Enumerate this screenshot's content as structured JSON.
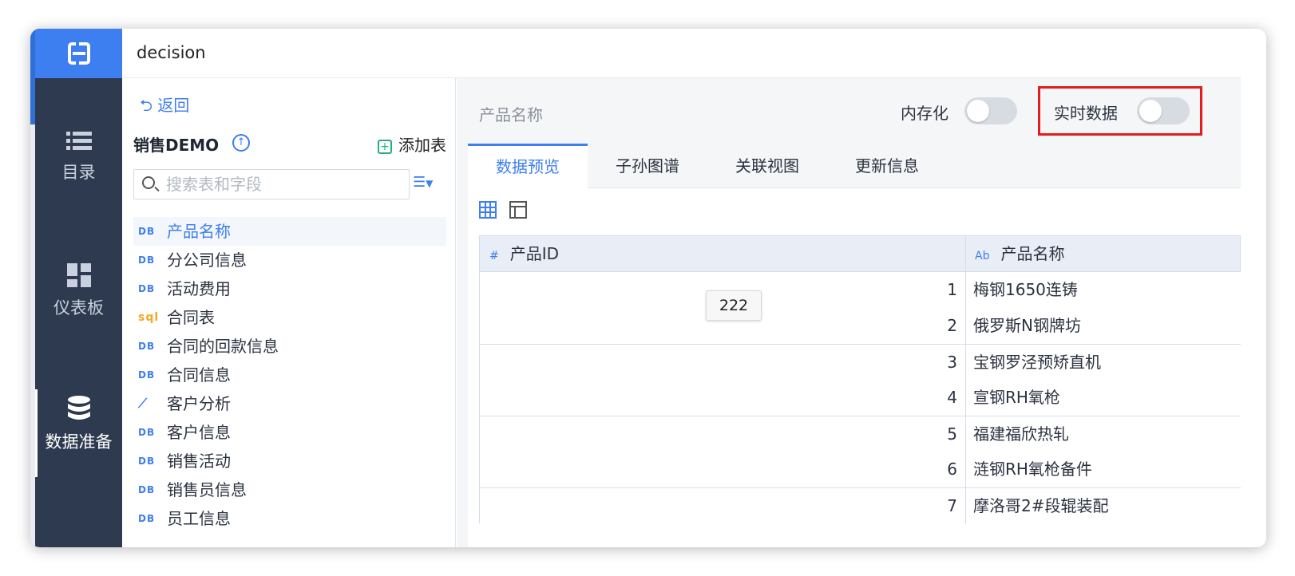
{
  "app": {
    "title": "decision"
  },
  "nav": {
    "items": [
      {
        "label": "目录",
        "icon": "list-icon"
      },
      {
        "label": "仪表板",
        "icon": "dashboard-icon"
      },
      {
        "label": "数据准备",
        "icon": "database-icon",
        "active": true
      }
    ]
  },
  "left_panel": {
    "back_label": "返回",
    "package_name": "销售DEMO",
    "add_table_label": "添加表",
    "search_placeholder": "搜索表和字段",
    "tables": [
      {
        "tag": "DB",
        "label": "产品名称",
        "selected": true
      },
      {
        "tag": "DB",
        "label": "分公司信息"
      },
      {
        "tag": "DB",
        "label": "活动费用"
      },
      {
        "tag": "sql",
        "label": "合同表"
      },
      {
        "tag": "DB",
        "label": "合同的回款信息"
      },
      {
        "tag": "DB",
        "label": "合同信息"
      },
      {
        "tag": "analysis",
        "label": "客户分析"
      },
      {
        "tag": "DB",
        "label": "客户信息"
      },
      {
        "tag": "DB",
        "label": "销售活动"
      },
      {
        "tag": "DB",
        "label": "销售员信息"
      },
      {
        "tag": "DB",
        "label": "员工信息"
      }
    ]
  },
  "right_panel": {
    "title": "产品名称",
    "memory_label": "内存化",
    "realtime_label": "实时数据",
    "tabs": [
      "数据预览",
      "子孙图谱",
      "关联视图",
      "更新信息"
    ],
    "columns": [
      {
        "type": "#",
        "label": "产品ID"
      },
      {
        "type": "Ab",
        "label": "产品名称"
      }
    ],
    "rows": [
      {
        "id": "1",
        "name": "梅钢1650连铸"
      },
      {
        "id": "2",
        "name": "俄罗斯N钢牌坊"
      },
      {
        "id": "3",
        "name": "宝钢罗泾预矫直机"
      },
      {
        "id": "4",
        "name": "宣钢RH氧枪"
      },
      {
        "id": "5",
        "name": "福建福欣热轧"
      },
      {
        "id": "6",
        "name": "涟钢RH氧枪备件"
      },
      {
        "id": "7",
        "name": "摩洛哥2#段辊装配"
      }
    ],
    "tooltip": "222"
  },
  "colors": {
    "accent": "#3d7ef0",
    "rail": "#2e3a4f",
    "highlight": "#e11d1d"
  }
}
